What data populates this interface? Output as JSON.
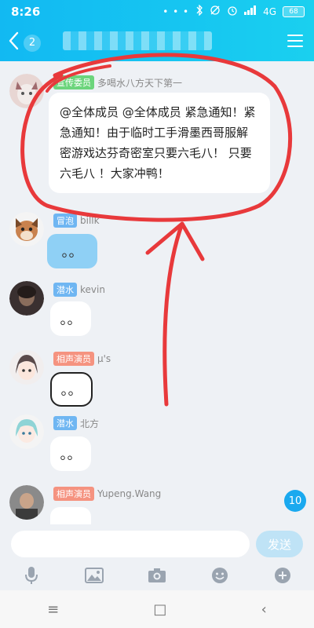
{
  "status_bar": {
    "time": "8:26",
    "dots": "• • •",
    "network": "4G",
    "battery": "68"
  },
  "nav": {
    "back_badge": "2"
  },
  "messages": [
    {
      "tag": "宣传委员",
      "name": "多喝水八方天下第一",
      "text": "@全体成员 @全体成员 紧急通知！紧急通知！由于临时工手滑墨西哥服解密游戏达芬奇密室只要六毛八！ 只要六毛八 ！大家冲鸭！"
    },
    {
      "tag": "冒泡",
      "name": "billk",
      "sticker": "。。"
    },
    {
      "tag": "潜水",
      "name": "kevin",
      "sticker": "。。"
    },
    {
      "tag": "相声演员",
      "name": "μ's",
      "sticker": "。。"
    },
    {
      "tag": "潜水",
      "name": "北方",
      "sticker": "。。"
    },
    {
      "tag": "相声演员",
      "name": "Yupeng.Wang",
      "sticker": ""
    }
  ],
  "unread_count": "10",
  "input": {
    "placeholder": "",
    "send_label": "发送"
  },
  "toolbar_icons": [
    "mic-icon",
    "image-icon",
    "camera-icon",
    "emoji-icon",
    "plus-icon"
  ],
  "system_nav": {
    "menu": "≡",
    "home": "□",
    "back": "‹"
  },
  "colors": {
    "header": "#16c6f1",
    "annotation": "#e8393b",
    "tag_green": "#6cd57c",
    "tag_blue": "#6fb6f2",
    "tag_orange": "#f59380",
    "unread": "#1aa9ef"
  }
}
